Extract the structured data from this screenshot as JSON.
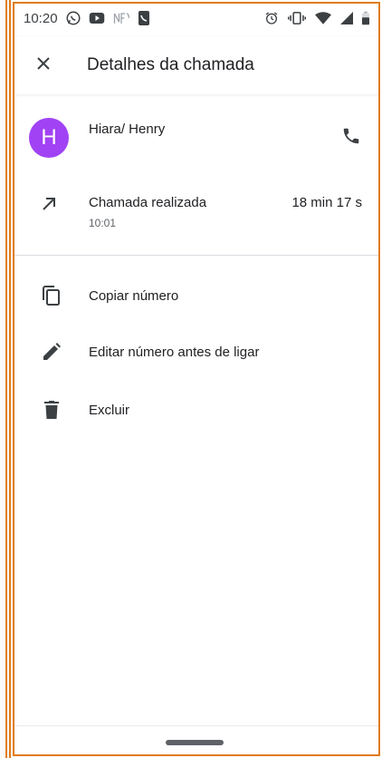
{
  "status_bar": {
    "time": "10:20",
    "left_icons": [
      "whatsapp-icon",
      "youtube-icon",
      "nfc-icon",
      "phone-screen-icon"
    ],
    "right_icons": [
      "alarm-icon",
      "vibrate-icon",
      "wifi-icon",
      "signal-icon",
      "battery-icon"
    ]
  },
  "app_bar": {
    "close_icon": "close-icon",
    "title": "Detalhes da chamada"
  },
  "contact": {
    "avatar_letter": "H",
    "avatar_color": "#a142f4",
    "name": "Hiara/ Henry",
    "call_icon": "phone-icon"
  },
  "call_detail": {
    "icon": "outgoing-call-icon",
    "type": "Chamada realizada",
    "time": "10:01",
    "duration": "18 min 17 s"
  },
  "actions": [
    {
      "icon": "copy-icon",
      "label": "Copiar número"
    },
    {
      "icon": "edit-icon",
      "label": "Editar número antes de ligar"
    },
    {
      "icon": "delete-icon",
      "label": "Excluir"
    }
  ],
  "colors": {
    "accent_border": "#e07b1a",
    "text_primary": "#202124",
    "text_secondary": "#5f6368",
    "icon": "#3c4043"
  }
}
